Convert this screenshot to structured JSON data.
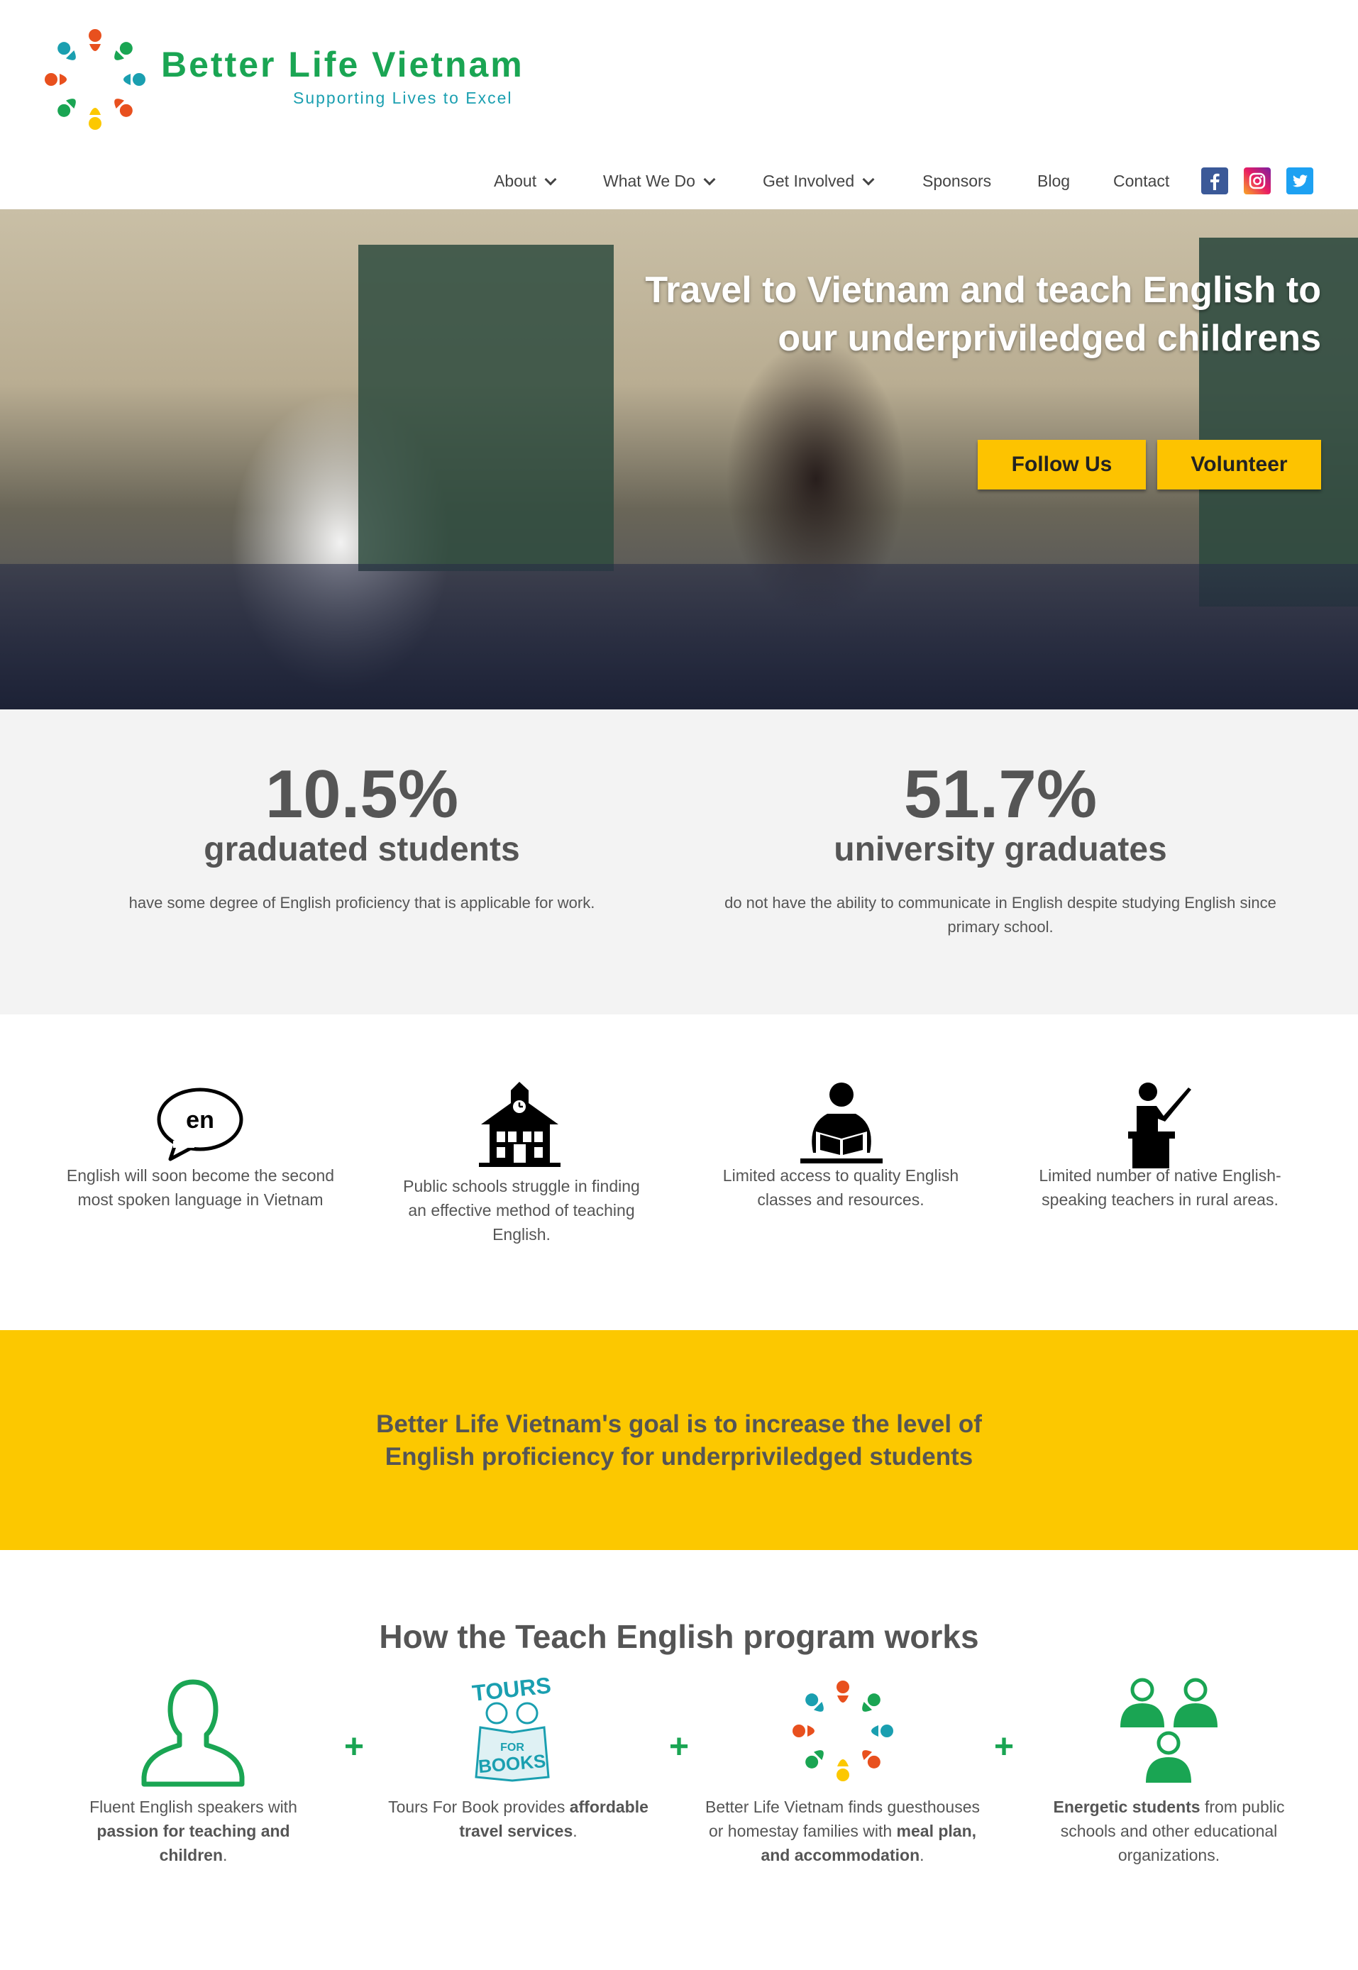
{
  "brand": {
    "name": "Better Life Vietnam",
    "tagline": "Supporting Lives to Excel",
    "colors": {
      "green": "#1aa553",
      "teal": "#1a9fb0",
      "yellow": "#fcc800"
    }
  },
  "nav": {
    "items": [
      {
        "label": "About",
        "dropdown": true
      },
      {
        "label": "What We Do",
        "dropdown": true
      },
      {
        "label": "Get Involved",
        "dropdown": true
      },
      {
        "label": "Sponsors",
        "dropdown": false
      },
      {
        "label": "Blog",
        "dropdown": false
      },
      {
        "label": "Contact",
        "dropdown": false
      }
    ],
    "social": [
      {
        "name": "facebook-icon",
        "glyph": "f"
      },
      {
        "name": "instagram-icon",
        "glyph": "◎"
      },
      {
        "name": "twitter-icon",
        "glyph": "🐦"
      }
    ]
  },
  "hero": {
    "title_line1": "Travel to Vietnam and teach English to",
    "title_line2": "our underpriviledged childrens",
    "follow_label": "Follow Us",
    "volunteer_label": "Volunteer"
  },
  "stats": [
    {
      "number": "10.5%",
      "label": "graduated students",
      "desc": "have some degree of English proficiency that is applicable for work."
    },
    {
      "number": "51.7%",
      "label": "university graduates",
      "desc_line1": "do not have the ability to communicate in English despite studying English since",
      "desc_line2": "primary school."
    }
  ],
  "problems": [
    {
      "icon": "speech-bubble-en-icon",
      "bubble_text": "en",
      "line1": "English will soon become the second",
      "line2": "most spoken language in Vietnam"
    },
    {
      "icon": "school-house-icon",
      "line1": "Public schools struggle in finding",
      "line2": "an effective method of teaching",
      "line3": "English."
    },
    {
      "icon": "reader-icon",
      "line1": "Limited access to quality English",
      "line2": "classes and resources."
    },
    {
      "icon": "teacher-icon",
      "line1": "Limited number of native English-",
      "line2": "speaking teachers in rural areas."
    }
  ],
  "goal": {
    "line1": "Better Life Vietnam's goal is to increase the level of",
    "line2": "English proficiency for underpriviledged students"
  },
  "how": {
    "title": "How the Teach English program works",
    "plus": "+",
    "tours_logo": {
      "top": "TOURS",
      "mid": "FOR",
      "bottom": "BOOKS"
    },
    "cols": [
      {
        "icon": "person-outline-icon",
        "pre": "Fluent English speakers with",
        "bold": "passion for teaching and children",
        "post": "."
      },
      {
        "icon": "tours-for-books-logo",
        "pre": "Tours For Book provides ",
        "bold": "affordable travel services",
        "post": "."
      },
      {
        "icon": "better-life-logo-icon",
        "pre": "Better Life Vietnam finds guesthouses or homestay families with ",
        "bold": "meal plan, and accommodation",
        "post": "."
      },
      {
        "icon": "students-group-icon",
        "bold": "Energetic students",
        "post": " from public schools and other educational organizations."
      }
    ]
  }
}
